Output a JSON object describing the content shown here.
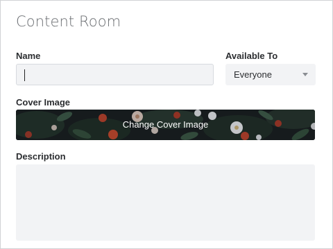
{
  "page": {
    "title": "Content Room"
  },
  "form": {
    "name_label": "Name",
    "name_value": "",
    "available_to_label": "Available To",
    "available_to_value": "Everyone",
    "cover_label": "Cover Image",
    "cover_button_label": "Change Cover Image",
    "description_label": "Description",
    "description_value": ""
  },
  "icons": {
    "select_arrow": "chevron-down-icon"
  },
  "colors": {
    "input_bg": "#f2f3f5",
    "cover_bg": "#1b2226"
  }
}
